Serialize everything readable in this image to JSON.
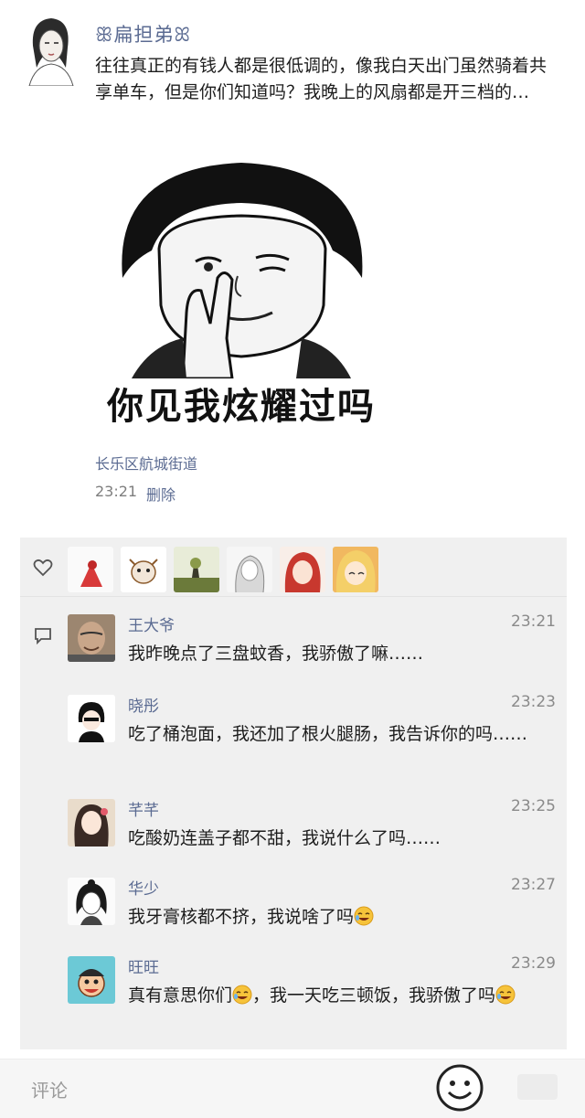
{
  "post": {
    "author": "ꕥ扁担弟ꕤ",
    "text": "往往真正的有钱人都是很低调的，像我白天出门虽然骑着共享单车，但是你们知道吗？我晚上的风扇都是开三档的…",
    "meme_caption": "你见我炫耀过吗",
    "location": "长乐区航城街道",
    "time": "23:21",
    "delete_label": "删除"
  },
  "likes": {
    "icon": "heart-icon",
    "avatars": [
      "avatar-bird",
      "avatar-cartoon-cow",
      "avatar-landscape",
      "avatar-sketch-girl",
      "avatar-red-hair-girl",
      "avatar-blonde-girl"
    ]
  },
  "comments": [
    {
      "name": "王大爷",
      "time": "23:21",
      "text": "我昨晚点了三盘蚊香，我骄傲了嘛……"
    },
    {
      "name": "晓彤",
      "time": "23:23",
      "text": "吃了桶泡面，我还加了根火腿肠，我告诉你的吗……"
    },
    {
      "name": "芊芊",
      "time": "23:25",
      "text": "吃酸奶连盖子都不甜，我说什么了吗……"
    },
    {
      "name": "华少",
      "time": "23:27",
      "text": "我牙膏核都不挤，我说啥了吗"
    },
    {
      "name": "旺旺",
      "time": "23:29",
      "text_a": "真有意思你们",
      "text_b": "，我一天吃三顿饭，我骄傲了吗"
    }
  ],
  "bottom_bar": {
    "placeholder": "评论"
  },
  "colors": {
    "name_link": "#5b6b92",
    "comment_bg": "#f0f0f0"
  }
}
